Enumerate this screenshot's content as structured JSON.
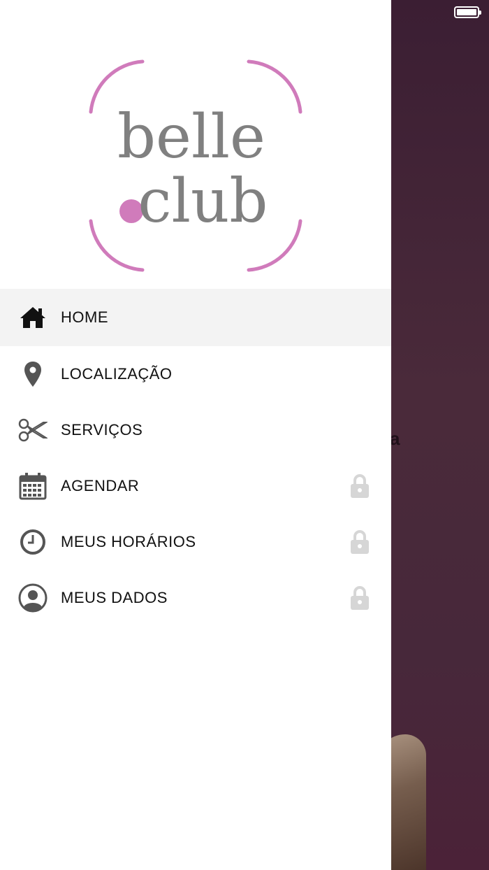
{
  "app": {
    "logo_line1": "belle",
    "logo_line2": ".club",
    "brand_pink": "#d07bbb",
    "brand_gray": "#808080"
  },
  "status_bar": {
    "battery_icon": "battery-full-icon"
  },
  "background": {
    "partial_text": "a"
  },
  "menu": {
    "items": [
      {
        "label": "HOME",
        "icon": "home-icon",
        "active": true,
        "locked": false
      },
      {
        "label": "LOCALIZAÇÃO",
        "icon": "map-pin-icon",
        "active": false,
        "locked": false
      },
      {
        "label": "SERVIÇOS",
        "icon": "scissors-icon",
        "active": false,
        "locked": false
      },
      {
        "label": "AGENDAR",
        "icon": "calendar-icon",
        "active": false,
        "locked": true
      },
      {
        "label": "MEUS HORÁRIOS",
        "icon": "clock-icon",
        "active": false,
        "locked": true
      },
      {
        "label": "MEUS DADOS",
        "icon": "user-circle-icon",
        "active": false,
        "locked": true
      }
    ]
  }
}
